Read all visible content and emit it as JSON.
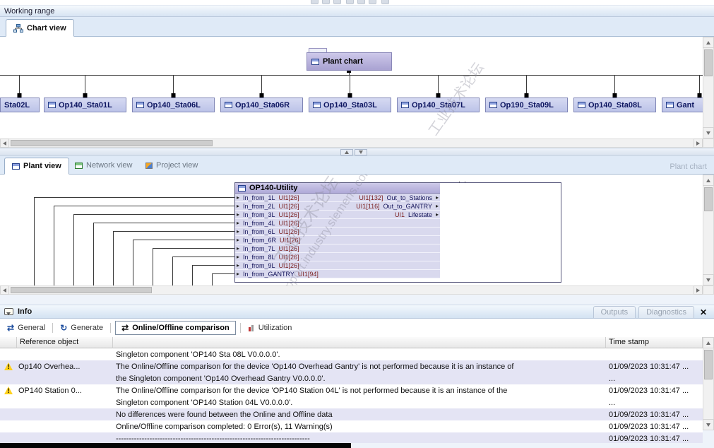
{
  "top": {
    "working_range_title": "Working range"
  },
  "chart_view": {
    "tab_label": "Chart view",
    "root_label": "Plant chart",
    "nodes": [
      "Sta02L",
      "Op140_Sta01L",
      "Op140_Sta06L",
      "Op140_Sta06R",
      "Op140_Sta03L",
      "Op140_Sta07L",
      "Op190_Sta09L",
      "Op140_Sta08L",
      "Gant"
    ]
  },
  "plant_view": {
    "tabs": [
      {
        "label": "Plant view",
        "active": true
      },
      {
        "label": "Network view",
        "active": false
      },
      {
        "label": "Project view",
        "active": false
      }
    ],
    "right_label": "Plant chart",
    "block": {
      "title": "OP140-Utility",
      "inputs": [
        {
          "name": "In_from_1L",
          "type": "UI1[26]"
        },
        {
          "name": "In_from_2L",
          "type": "UI1[26]"
        },
        {
          "name": "In_from_3L",
          "type": "UI1[26]"
        },
        {
          "name": "In_from_4L",
          "type": "UI1[26]"
        },
        {
          "name": "In_from_6L",
          "type": "UI1[26]"
        },
        {
          "name": "In_from_6R",
          "type": "UI1[26]"
        },
        {
          "name": "In_from_7L",
          "type": "UI1[26]"
        },
        {
          "name": "In_from_8L",
          "type": "UI1[26]"
        },
        {
          "name": "In_from_9L",
          "type": "UI1[26]"
        },
        {
          "name": "In_from_GANTRY",
          "type": "UI1[94]"
        }
      ],
      "outputs": [
        {
          "type": "UI1[132]",
          "name": "Out_to_Stations"
        },
        {
          "type": "UI1[116]",
          "name": "Out_to_GANTRY"
        },
        {
          "type": "UI1",
          "name": "Lifestate"
        }
      ]
    },
    "watermark": [
      "工业技术论坛",
      "support.industry.siemens.com"
    ]
  },
  "info": {
    "title": "Info",
    "corner_buttons": [
      {
        "label": "Outputs"
      },
      {
        "label": "Diagnostics"
      }
    ],
    "close_glyph": "✕",
    "tabs": [
      {
        "label": "General",
        "active": false
      },
      {
        "label": "Generate",
        "active": false
      },
      {
        "label": "Online/Offline comparison",
        "active": true
      },
      {
        "label": "Utilization",
        "active": false
      }
    ],
    "columns": {
      "reference": "Reference object",
      "time": "Time stamp"
    },
    "rows": [
      {
        "warning": false,
        "reference": "",
        "message": "Singleton component 'OP140 Sta 08L V0.0.0.0'.",
        "time": "",
        "shaded": false
      },
      {
        "warning": true,
        "reference": "Op140 Overhea...",
        "message": "The Online/Offline comparison for the device 'Op140 Overhead Gantry' is not performed because it is an instance of",
        "time": "01/09/2023 10:31:47 ...",
        "shaded": true
      },
      {
        "warning": false,
        "reference": "",
        "message": "the Singleton component 'Op140 Overhead Gantry V0.0.0.0'.",
        "time": "...",
        "shaded": true
      },
      {
        "warning": true,
        "reference": "OP140 Station 0...",
        "message": "The Online/Offline comparison for the device 'OP140 Station 04L' is not performed because it is an instance of the",
        "time": "01/09/2023 10:31:47 ...",
        "shaded": false
      },
      {
        "warning": false,
        "reference": "",
        "message": "Singleton component 'OP140 Station 04L V0.0.0.0'.",
        "time": "...",
        "shaded": false
      },
      {
        "warning": false,
        "reference": "",
        "message": "No differences were found between the Online and Offline data",
        "time": "01/09/2023 10:31:47 ...",
        "shaded": true
      },
      {
        "warning": false,
        "reference": "",
        "message": "Online/Offline comparison completed: 0 Error(s), 11 Warning(s)",
        "time": "01/09/2023 10:31:47 ...",
        "shaded": false
      },
      {
        "warning": false,
        "reference": "",
        "message": "---------------------------------------------------------------------------",
        "time": "01/09/2023 10:31:47 ...",
        "shaded": true
      }
    ]
  }
}
